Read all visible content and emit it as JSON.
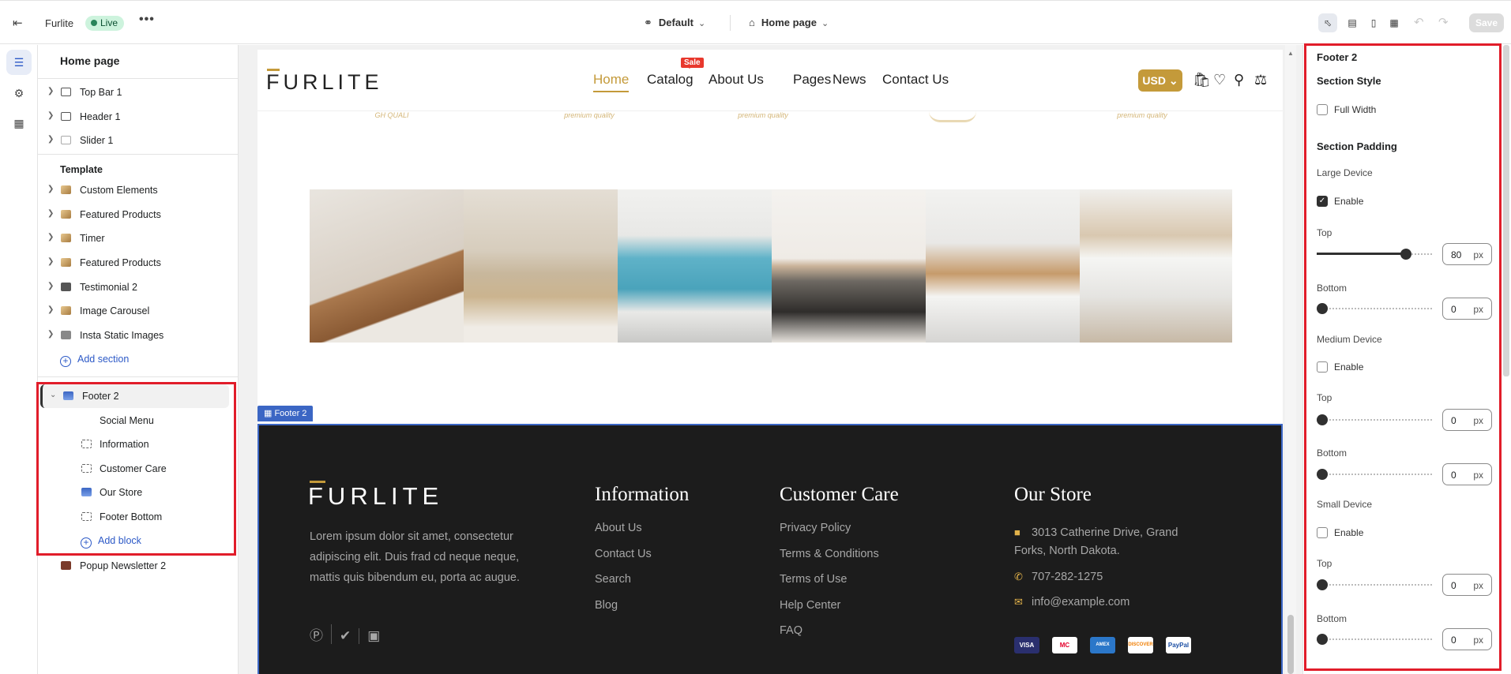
{
  "topbar": {
    "store_name": "Furlite",
    "live_label": "Live",
    "more_label": "•••",
    "theme_label": "Default",
    "page_label": "Home page",
    "save_label": "Save"
  },
  "left_panel": {
    "title": "Home page",
    "header_sections": [
      {
        "label": "Top Bar 1",
        "icon": "layout-icon"
      },
      {
        "label": "Header 1",
        "icon": "header-icon"
      },
      {
        "label": "Slider 1",
        "icon": "image-icon"
      }
    ],
    "template_label": "Template",
    "template_sections": [
      {
        "label": "Custom Elements"
      },
      {
        "label": "Featured Products"
      },
      {
        "label": "Timer"
      },
      {
        "label": "Featured Products"
      },
      {
        "label": "Testimonial 2"
      },
      {
        "label": "Image Carousel"
      },
      {
        "label": "Insta Static Images"
      }
    ],
    "add_section_label": "Add section",
    "footer_section": {
      "label": "Footer 2",
      "blocks": [
        {
          "label": "Social Menu",
          "icon": "none"
        },
        {
          "label": "Information",
          "icon": "block-icon"
        },
        {
          "label": "Customer Care",
          "icon": "block-icon"
        },
        {
          "label": "Our Store",
          "icon": "store-image-icon"
        },
        {
          "label": "Footer Bottom",
          "icon": "block-icon"
        }
      ],
      "add_block_label": "Add block"
    },
    "popup_section": {
      "label": "Popup Newsletter 2"
    }
  },
  "preview": {
    "logo_text": "FURLITE",
    "nav": [
      "Home",
      "Catalog",
      "About Us",
      "Pages",
      "News",
      "Contact Us"
    ],
    "sale_badge": "Sale",
    "currency": "USD",
    "brand_strip": [
      "GH QUALI",
      "premium quality",
      "premium quality",
      "",
      "premium quality"
    ],
    "section_tag": "Footer 2",
    "footer": {
      "description": "Lorem ipsum dolor sit amet, consectetur adipiscing elit. Duis frad cd neque neque, mattis quis bibendum eu, porta ac augue.",
      "information_title": "Information",
      "information_links": [
        "About Us",
        "Contact Us",
        "Search",
        "Blog"
      ],
      "care_title": "Customer Care",
      "care_links": [
        "Privacy Policy",
        "Terms & Conditions",
        "Terms of Use",
        "Help Center",
        "FAQ"
      ],
      "store_title": "Our Store",
      "address": "3013 Catherine Drive, Grand Forks, North Dakota.",
      "phone": "707-282-1275",
      "email": "info@example.com",
      "payments": [
        "VISA",
        "MC",
        "AMEX",
        "DISCOVER",
        "PayPal"
      ]
    }
  },
  "right_panel": {
    "title": "Footer 2",
    "section_style_label": "Section Style",
    "full_width_label": "Full Width",
    "section_padding_label": "Section Padding",
    "large_device_label": "Large Device",
    "medium_device_label": "Medium Device",
    "small_device_label": "Small Device",
    "enable_label": "Enable",
    "top_label": "Top",
    "bottom_label": "Bottom",
    "unit": "px",
    "large": {
      "enabled": true,
      "top": "80",
      "bottom": "0"
    },
    "medium": {
      "enabled": false,
      "top": "0",
      "bottom": "0"
    },
    "small": {
      "enabled": false,
      "top": "0",
      "bottom": "0"
    }
  },
  "colors": {
    "accent": "#c49a3a",
    "selection": "#3b66c4",
    "highlight": "#e11d2a",
    "footer_bg": "#1c1c1c"
  }
}
